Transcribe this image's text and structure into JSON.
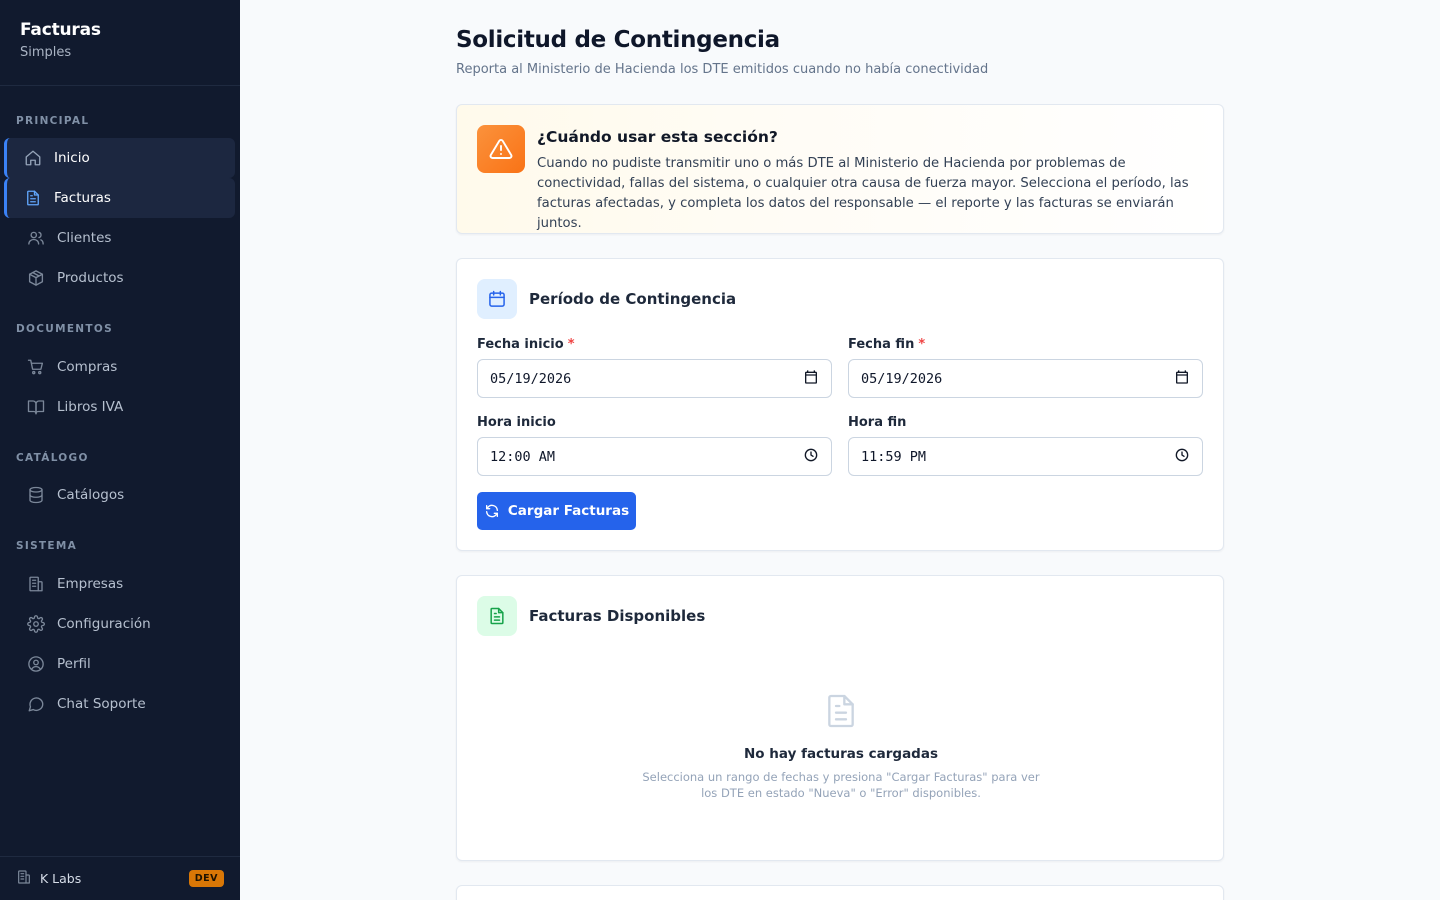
{
  "brand": {
    "title": "Facturas",
    "subtitle": "Simples"
  },
  "sidebar": {
    "sections": {
      "principal": "PRINCIPAL",
      "documentos": "DOCUMENTOS",
      "catalogo": "CATÁLOGO",
      "sistema": "SISTEMA"
    },
    "items": {
      "inicio": "Inicio",
      "facturas": "Facturas",
      "clientes": "Clientes",
      "productos": "Productos",
      "compras": "Compras",
      "libros_iva": "Libros IVA",
      "catalogos": "Catálogos",
      "empresas": "Empresas",
      "configuracion": "Configuración",
      "perfil": "Perfil",
      "chat_soporte": "Chat Soporte"
    },
    "footer": {
      "company": "K Labs",
      "env_badge": "DEV"
    }
  },
  "page": {
    "title": "Solicitud de Contingencia",
    "subtitle": "Reporta al Ministerio de Hacienda los DTE emitidos cuando no había conectividad"
  },
  "info": {
    "title": "¿Cuándo usar esta sección?",
    "text": "Cuando no pudiste transmitir uno o más DTE al Ministerio de Hacienda por problemas de conectividad, fallas del sistema, o cualquier otra causa de fuerza mayor. Selecciona el período, las facturas afectadas, y completa los datos del responsable — el reporte y las facturas se enviarán juntos."
  },
  "period": {
    "title": "Período de Contingencia",
    "fecha_inicio_label": "Fecha inicio",
    "fecha_inicio_value": "05/19/2026",
    "fecha_fin_label": "Fecha fin",
    "fecha_fin_value": "05/19/2026",
    "hora_inicio_label": "Hora inicio",
    "hora_inicio_value": "12:00 AM",
    "hora_fin_label": "Hora fin",
    "hora_fin_value": "11:59 PM",
    "required_mark": "*",
    "load_button": "Cargar Facturas"
  },
  "invoices": {
    "title": "Facturas Disponibles",
    "empty_title": "No hay facturas cargadas",
    "empty_text": "Selecciona un rango de fechas y presiona \"Cargar Facturas\" para ver los DTE en estado \"Nueva\" o \"Error\" disponibles."
  },
  "colors": {
    "sidebar_bg": "#111a2e",
    "accent": "#2563eb",
    "warning": "#f97316",
    "required": "#ef4444",
    "dev_badge": "#d97706"
  },
  "icons": {
    "inicio": "home-icon",
    "facturas": "file-text-icon",
    "clientes": "users-icon",
    "productos": "package-icon",
    "compras": "shopping-cart-icon",
    "libros_iva": "book-open-icon",
    "catalogos": "database-icon",
    "empresas": "building-icon",
    "configuracion": "gear-icon",
    "perfil": "user-circle-icon",
    "chat_soporte": "chat-icon"
  }
}
